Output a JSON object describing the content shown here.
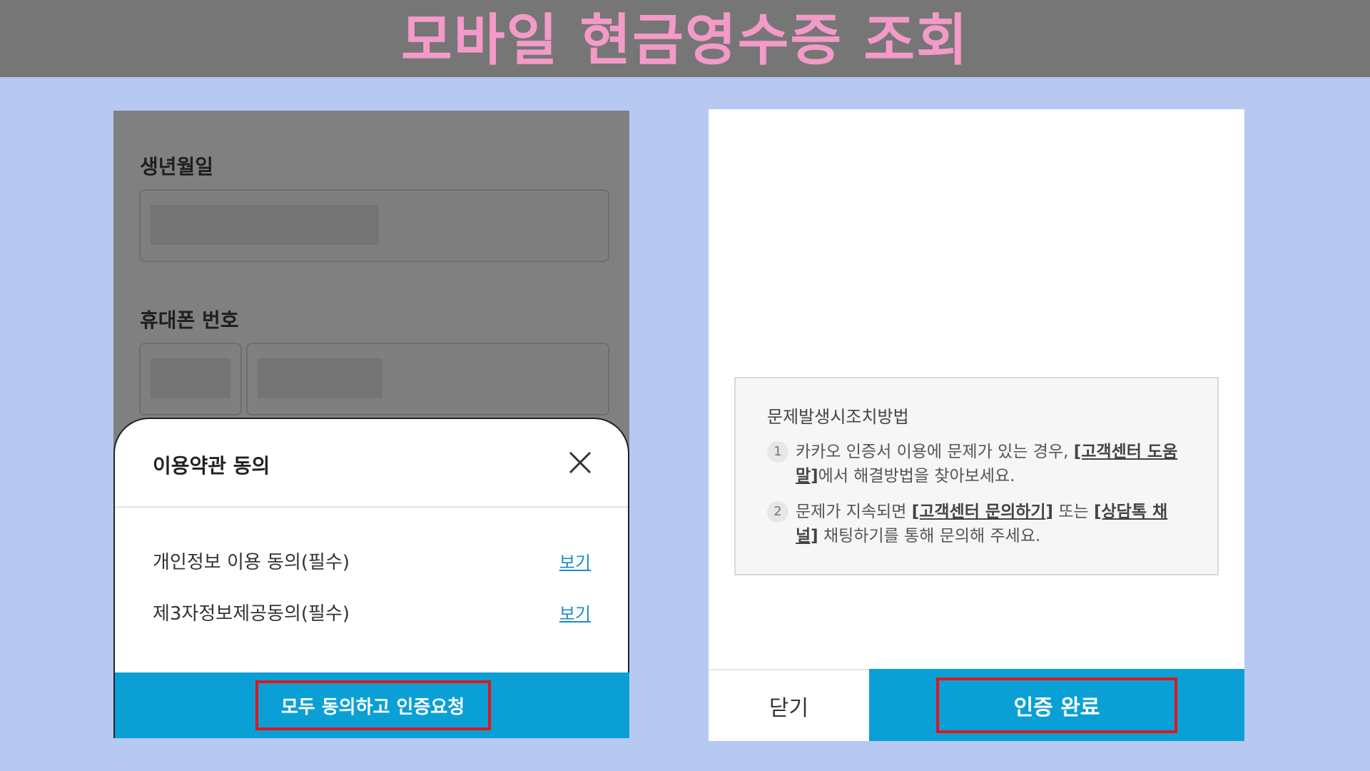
{
  "banner": {
    "title": "모바일 현금영수증 조회"
  },
  "left_panel": {
    "birthdate_label": "생년월일",
    "phone_label": "휴대폰 번호",
    "terms_sheet": {
      "title": "이용약관 동의",
      "items": [
        {
          "label": "개인정보 이용 동의(필수)",
          "link": "보기"
        },
        {
          "label": "제3자정보제공동의(필수)",
          "link": "보기"
        }
      ],
      "cta_label": "모두 동의하고 인증요청"
    }
  },
  "right_panel": {
    "help": {
      "title": "문제발생시조치방법",
      "items": [
        {
          "num": "1",
          "pre": "카카오 인증서 이용에 문제가 있는 경우, ",
          "link": "[고객센터 도움말]",
          "post": "에서 해결방법을 찾아보세요."
        },
        {
          "num": "2",
          "pre": "문제가 지속되면 ",
          "link": "[고객센터 문의하기]",
          "mid": " 또는 ",
          "link2": "[상담톡 채널]",
          "post": " 채팅하기를 통해 문의해 주세요."
        }
      ]
    },
    "close_label": "닫기",
    "confirm_label": "인증 완료"
  },
  "colors": {
    "accent": "#0aa0d6",
    "highlight": "#e0161b",
    "banner_text": "#f39ac8",
    "background": "#b7c8f1"
  }
}
